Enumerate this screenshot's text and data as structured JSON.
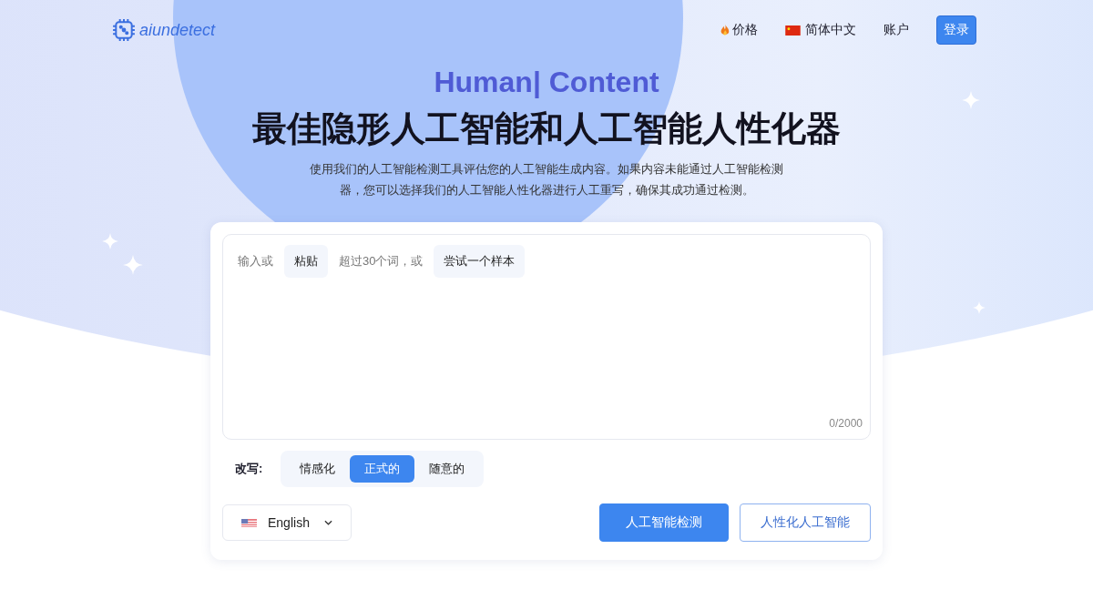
{
  "header": {
    "logo": "aiundetect",
    "nav": [
      {
        "kind": "pricing",
        "label": "价格"
      },
      {
        "kind": "language",
        "label": "简体中文"
      },
      {
        "kind": "link",
        "label": "账户"
      },
      {
        "kind": "button",
        "label": "登录"
      }
    ]
  },
  "hero": {
    "tagline": "Human| Content",
    "title": "最佳隐形人工智能和人工智能人性化器",
    "description": "使用我们的人工智能检测工具评估您的人工智能生成内容。如果内容未能通过人工智能检测器，您可以选择我们的人工智能人性化器进行人工重写，确保其成功通过检测。"
  },
  "editor": {
    "hints": [
      {
        "kind": "text",
        "label": "输入或"
      },
      {
        "kind": "button",
        "label": "粘贴"
      },
      {
        "kind": "text",
        "label": "超过30个词，或"
      },
      {
        "kind": "button",
        "label": "尝试一个样本"
      }
    ],
    "counter": "0/2000"
  },
  "rewrite": {
    "label": "改写:",
    "options": [
      {
        "label": "情感化",
        "selected": false
      },
      {
        "label": "正式的",
        "selected": true
      },
      {
        "label": "随意的",
        "selected": false
      }
    ]
  },
  "language_select": {
    "value": "English"
  },
  "actions": [
    {
      "kind": "primary",
      "label": "人工智能检测"
    },
    {
      "kind": "outline",
      "label": "人性化人工智能"
    }
  ]
}
